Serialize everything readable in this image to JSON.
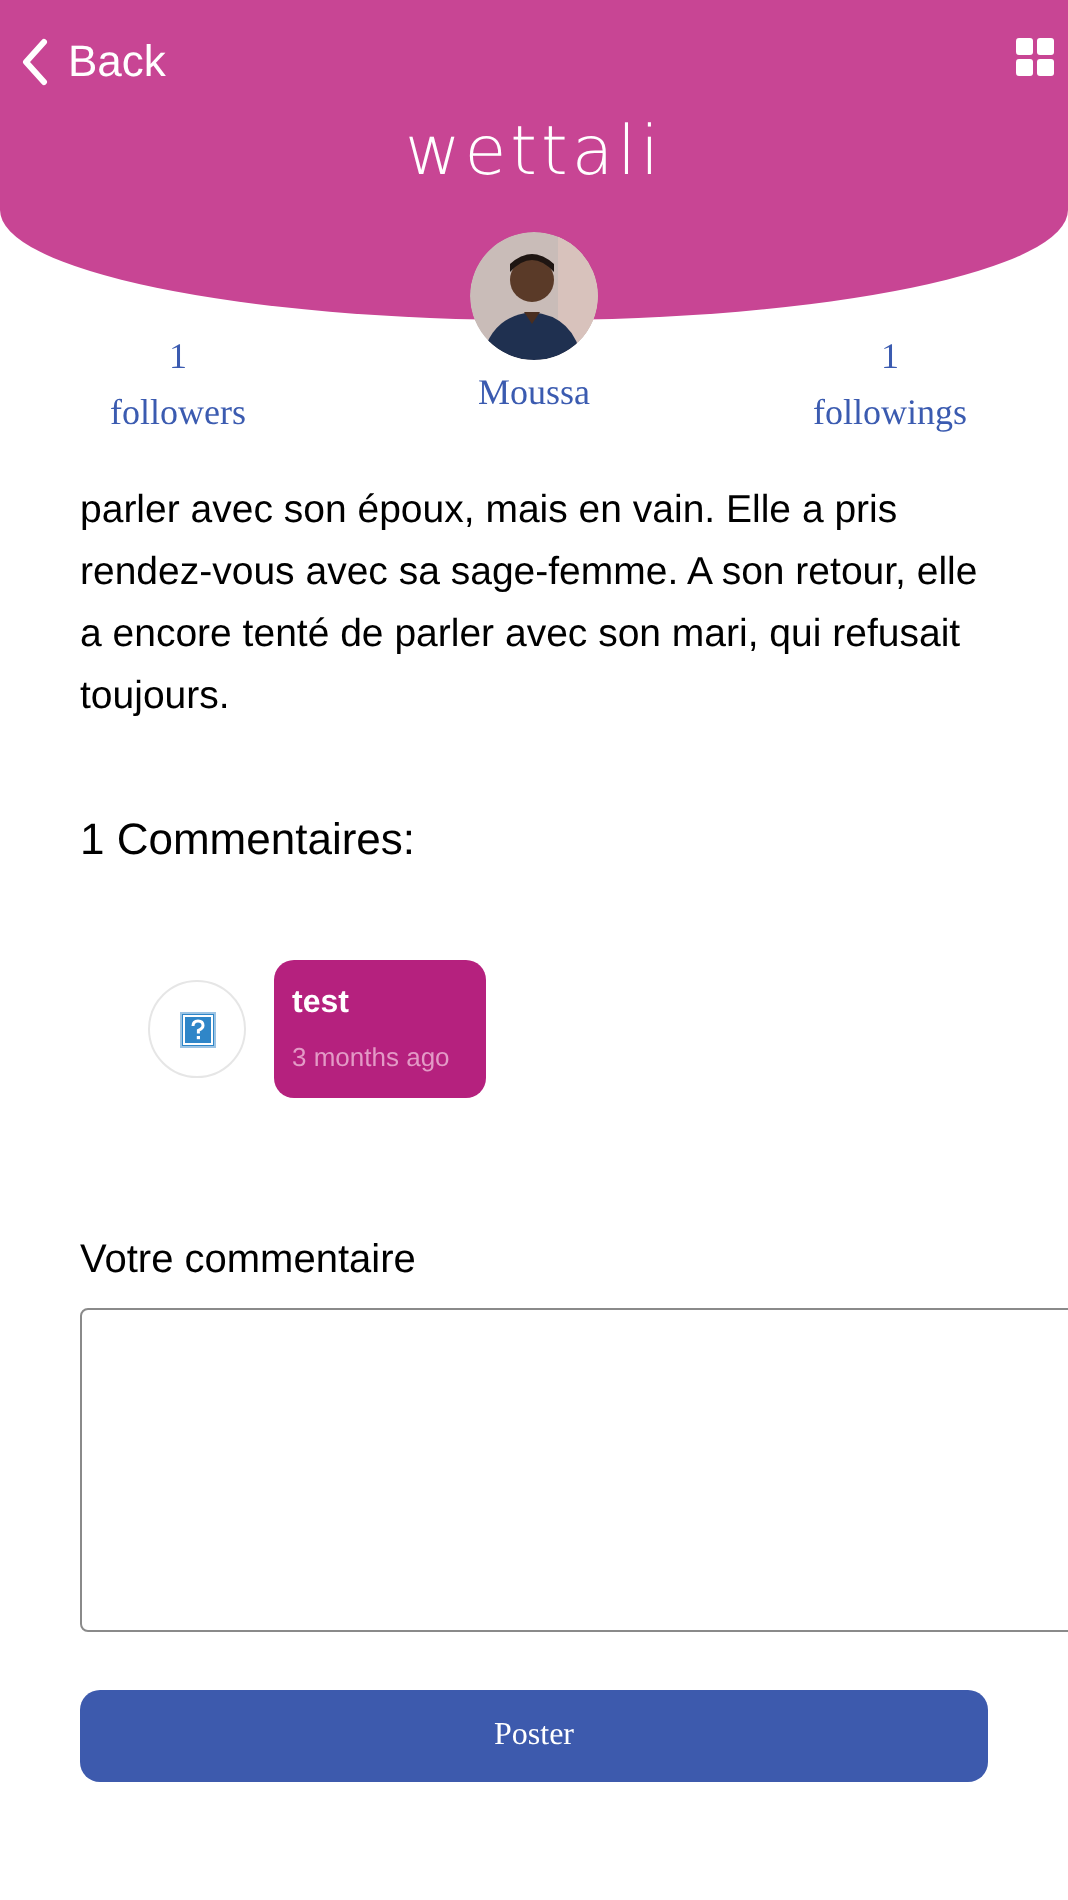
{
  "header": {
    "back_label": "Back",
    "logo": "wettali"
  },
  "profile": {
    "name": "Moussa",
    "followers": {
      "count": "1",
      "label": "followers"
    },
    "followings": {
      "count": "1",
      "label": "followings"
    }
  },
  "article_text": "parler avec son époux, mais en vain. Elle a pris rendez-vous avec sa sage-femme. A son retour, elle a encore tenté de parler avec son mari, qui refusait toujours.",
  "comments_heading": "1 Commentaires:",
  "comments": [
    {
      "text": "test",
      "time": "3 months ago"
    }
  ],
  "comment_form": {
    "label": "Votre commentaire",
    "submit": "Poster"
  }
}
